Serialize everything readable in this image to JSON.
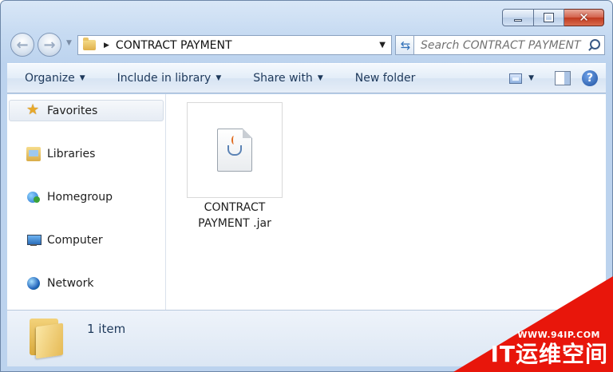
{
  "breadcrumb": {
    "current": "CONTRACT PAYMENT"
  },
  "search": {
    "placeholder": "Search CONTRACT PAYMENT"
  },
  "toolbar": {
    "organize": "Organize",
    "include_in_library": "Include in library",
    "share_with": "Share with",
    "new_folder": "New folder"
  },
  "navpane": {
    "favorites": "Favorites",
    "libraries": "Libraries",
    "homegroup": "Homegroup",
    "computer": "Computer",
    "network": "Network"
  },
  "files": [
    {
      "name": "CONTRACT PAYMENT .jar",
      "name_line1": "CONTRACT",
      "name_line2": "PAYMENT .jar",
      "icon": "java-jar-icon"
    }
  ],
  "details": {
    "item_count": "1 item"
  },
  "watermark": {
    "url": "WWW.94IP.COM",
    "text": "IT运维空间"
  },
  "colors": {
    "accent": "#1e395b",
    "watermark": "#e8160b"
  }
}
